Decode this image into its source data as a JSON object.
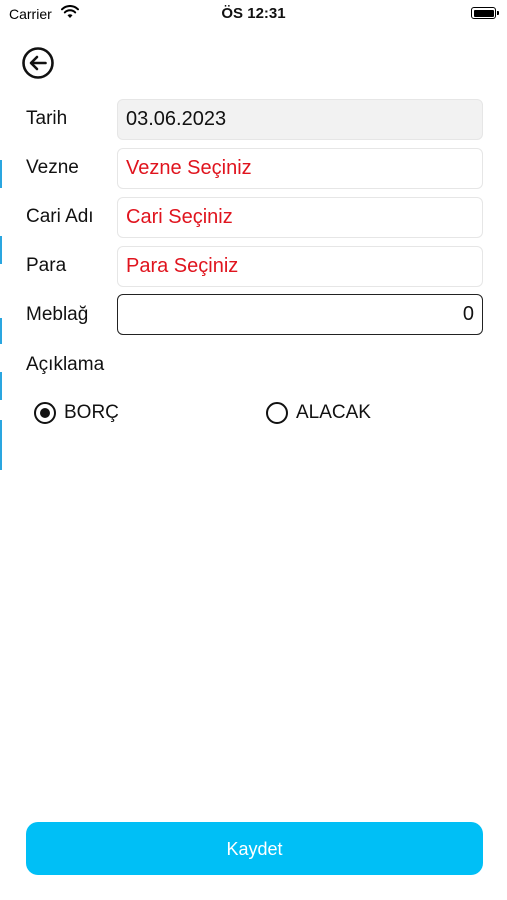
{
  "status_bar": {
    "carrier": "Carrier",
    "time": "ÖS 12:31"
  },
  "form": {
    "date_label": "Tarih",
    "date_value": "03.06.2023",
    "vezne_label": "Vezne",
    "vezne_value": "Vezne Seçiniz",
    "cari_label": "Cari Adı",
    "cari_value": "Cari Seçiniz",
    "para_label": "Para",
    "para_value": "Para Seçiniz",
    "meblag_label": "Meblağ",
    "meblag_value": "0",
    "aciklama_label": "Açıklama"
  },
  "options": {
    "borc_label": "BORÇ",
    "alacak_label": "ALACAK",
    "selected": "BORÇ"
  },
  "save_label": "Kaydet",
  "colors": {
    "accent": "#00bff6",
    "placeholder_red": "#e0141e",
    "readonly_bg": "#f2f2f2",
    "left_stripe": "#2aa6e0"
  },
  "icons": {
    "back": "arrow-left-circle-icon",
    "wifi": "wifi-icon",
    "battery": "battery-icon"
  }
}
